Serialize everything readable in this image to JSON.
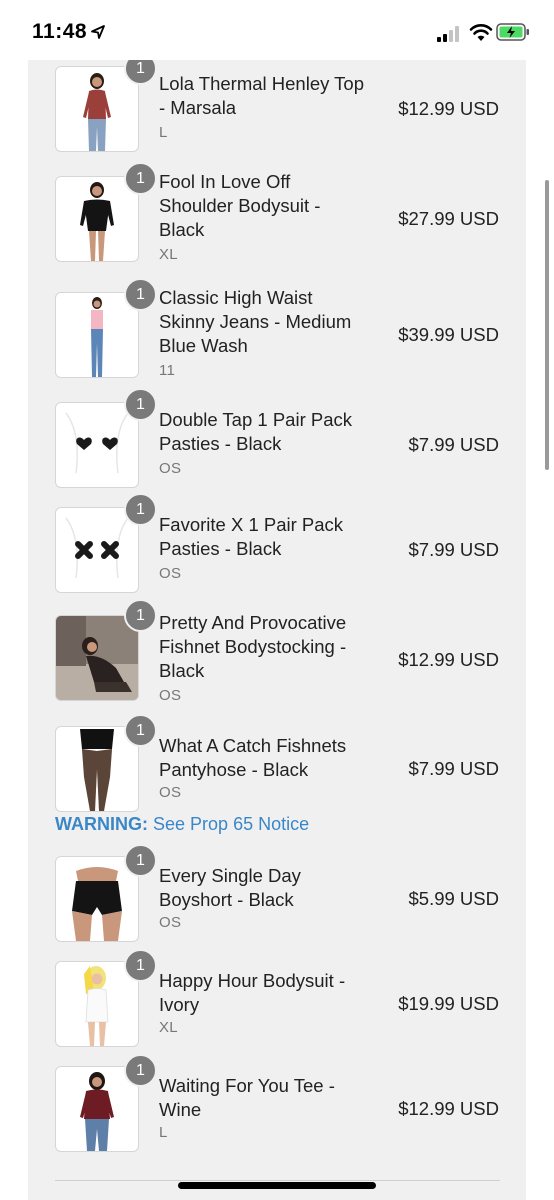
{
  "status_bar": {
    "time": "11:48",
    "icons": [
      "location-arrow-icon",
      "cellular-signal-icon",
      "wifi-icon",
      "battery-charging-icon"
    ]
  },
  "cart": {
    "items": [
      {
        "name": "Lola Thermal Henley Top - Marsala",
        "size": "L",
        "price": "$12.99 USD",
        "qty": "1"
      },
      {
        "name": "Fool In Love Off Shoulder Bodysuit - Black",
        "size": "XL",
        "price": "$27.99 USD",
        "qty": "1"
      },
      {
        "name": "Classic High Waist Skinny Jeans - Medium Blue Wash",
        "size": "11",
        "price": "$39.99 USD",
        "qty": "1"
      },
      {
        "name": "Double Tap 1 Pair Pack Pasties - Black",
        "size": "OS",
        "price": "$7.99 USD",
        "qty": "1"
      },
      {
        "name": "Favorite X 1 Pair Pack Pasties - Black",
        "size": "OS",
        "price": "$7.99 USD",
        "qty": "1"
      },
      {
        "name": "Pretty And Provocative Fishnet Bodystocking - Black",
        "size": "OS",
        "price": "$12.99 USD",
        "qty": "1"
      },
      {
        "name": "What A Catch Fishnets Pantyhose - Black",
        "size": "OS",
        "price": "$7.99 USD",
        "qty": "1"
      },
      {
        "name": "Every Single Day Boyshort - Black",
        "size": "OS",
        "price": "$5.99 USD",
        "qty": "1"
      },
      {
        "name": "Happy Hour Bodysuit - Ivory",
        "size": "XL",
        "price": "$19.99 USD",
        "qty": "1"
      },
      {
        "name": "Waiting For You Tee - Wine",
        "size": "L",
        "price": "$12.99 USD",
        "qty": "1"
      }
    ],
    "warning": {
      "label": "WARNING:",
      "link": "See Prop 65 Notice"
    }
  },
  "colors": {
    "panel_bg": "#f0f0f0",
    "link": "#3a87c8",
    "badge": "#7a7a7a",
    "battery": "#4cd964"
  }
}
